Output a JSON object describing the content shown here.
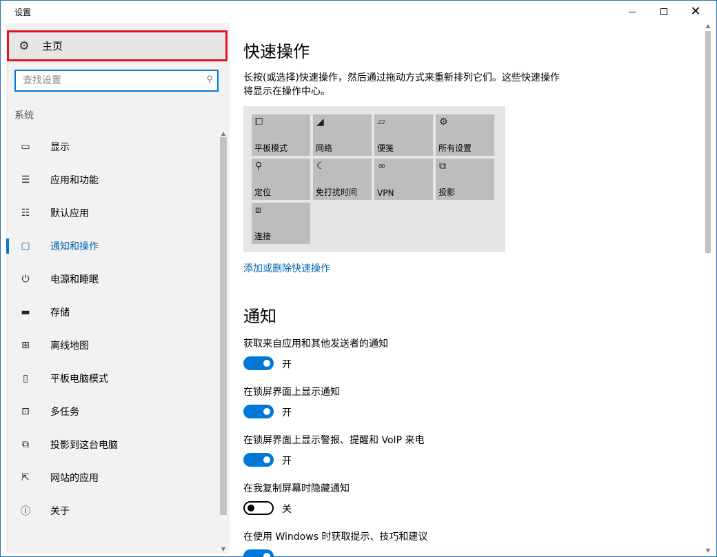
{
  "window": {
    "title": "设置"
  },
  "sidebar": {
    "home_label": "主页",
    "search_placeholder": "查找设置",
    "section": "系统",
    "items": [
      {
        "label": "显示",
        "icon": "monitor-icon"
      },
      {
        "label": "应用和功能",
        "icon": "list-icon"
      },
      {
        "label": "默认应用",
        "icon": "default-apps-icon"
      },
      {
        "label": "通知和操作",
        "icon": "notification-icon",
        "active": true
      },
      {
        "label": "电源和睡眠",
        "icon": "power-icon"
      },
      {
        "label": "存储",
        "icon": "storage-icon"
      },
      {
        "label": "离线地图",
        "icon": "map-icon"
      },
      {
        "label": "平板电脑模式",
        "icon": "tablet-icon"
      },
      {
        "label": "多任务",
        "icon": "multitask-icon"
      },
      {
        "label": "投影到这台电脑",
        "icon": "project-icon"
      },
      {
        "label": "网站的应用",
        "icon": "web-apps-icon"
      },
      {
        "label": "关于",
        "icon": "info-icon"
      }
    ]
  },
  "main": {
    "quick_actions_title": "快速操作",
    "quick_actions_desc": "长按(或选择)快速操作，然后通过拖动方式来重新排列它们。这些快速操作将显示在操作中心。",
    "tiles": [
      {
        "label": "平板模式",
        "icon": "tablet-mode-icon"
      },
      {
        "label": "网络",
        "icon": "network-icon"
      },
      {
        "label": "便笺",
        "icon": "note-icon"
      },
      {
        "label": "所有设置",
        "icon": "settings-icon"
      },
      {
        "label": "定位",
        "icon": "location-icon"
      },
      {
        "label": "免打扰时间",
        "icon": "moon-icon"
      },
      {
        "label": "VPN",
        "icon": "vpn-icon"
      },
      {
        "label": "投影",
        "icon": "project-icon"
      },
      {
        "label": "连接",
        "icon": "connect-icon"
      }
    ],
    "add_remove_link": "添加或删除快速操作",
    "notifications_title": "通知",
    "settings": [
      {
        "label": "获取来自应用和其他发送者的通知",
        "state": "开",
        "on": true
      },
      {
        "label": "在锁屏界面上显示通知",
        "state": "开",
        "on": true
      },
      {
        "label": "在锁屏界面上显示警报、提醒和 VoIP 来电",
        "state": "开",
        "on": true
      },
      {
        "label": "在我复制屏幕时隐藏通知",
        "state": "关",
        "on": false
      },
      {
        "label": "在使用 Windows 时获取提示、技巧和建议",
        "state": "",
        "on": true
      }
    ]
  }
}
